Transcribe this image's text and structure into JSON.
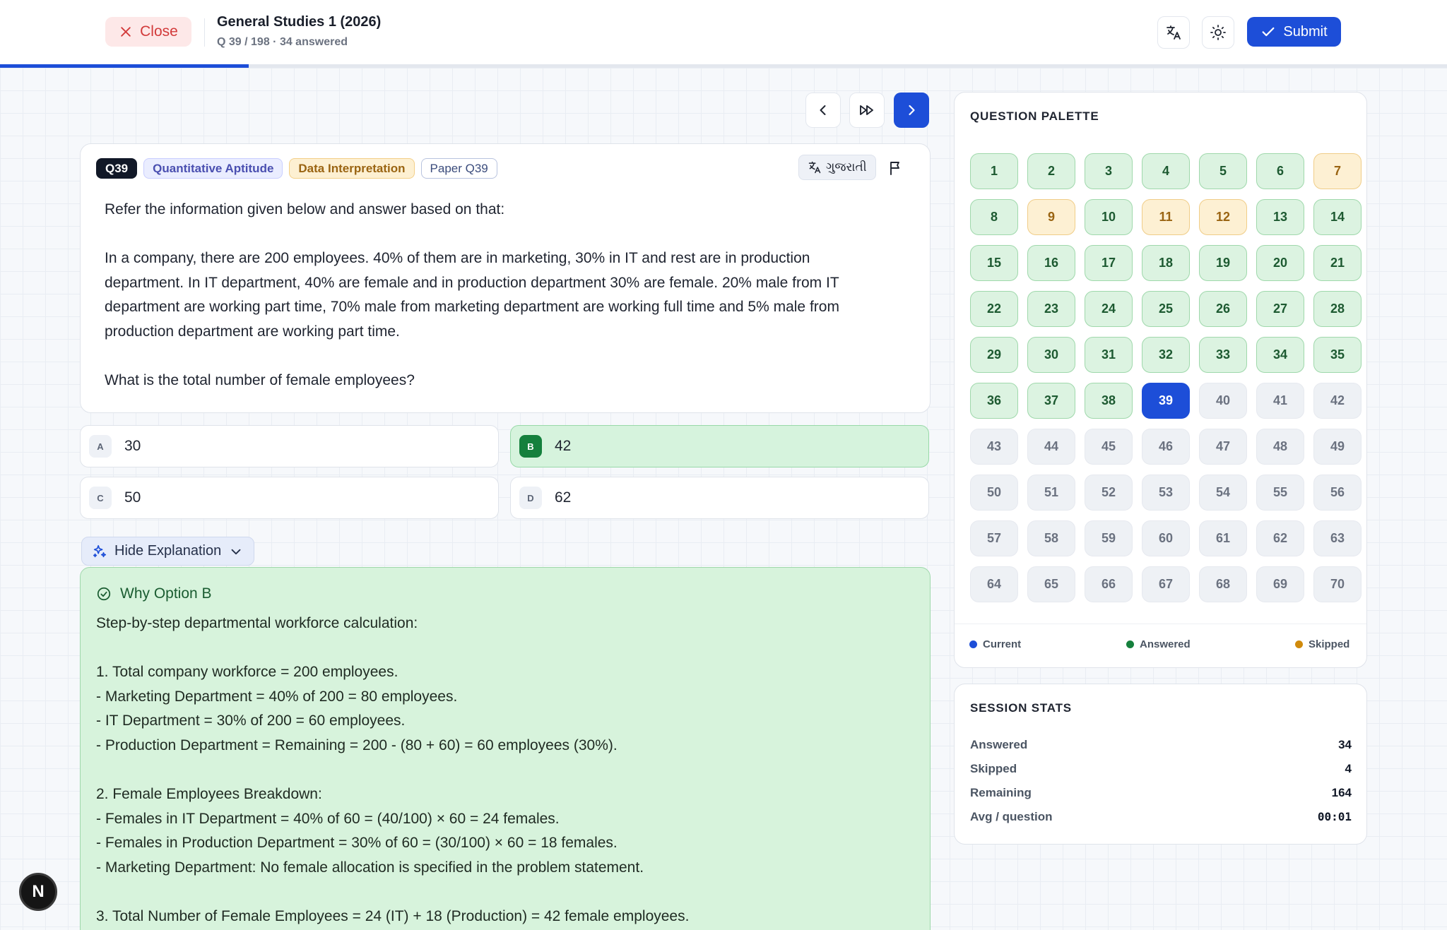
{
  "header": {
    "close_label": "Close",
    "title": "General Studies 1 (2026)",
    "subtitle": "Q 39 / 198 · 34 answered",
    "submit_label": "Submit",
    "progress_fraction": 0.172,
    "accent_color": "#1d4ed8"
  },
  "question": {
    "number_tag": "Q39",
    "subject_tag": "Quantitative Aptitude",
    "topic_tag": "Data Interpretation",
    "paper_tag": "Paper Q39",
    "language_label": "ગુજરાતી",
    "intro": "Refer the information given below and answer based on that:",
    "passage": [
      "In a company, there are 200 employees. 40% of them are in marketing, 30% in IT and rest are in production",
      "department. In IT department, 40% are female and in production department 30% are female. 20% male from IT",
      "department are working part time, 70% male from marketing department are working full time and 5% male from",
      "production department are working part time."
    ],
    "prompt": "What is the total number of female employees?"
  },
  "options": [
    {
      "letter": "A",
      "text": "30",
      "state": "default"
    },
    {
      "letter": "B",
      "text": "42",
      "state": "correct"
    },
    {
      "letter": "C",
      "text": "50",
      "state": "default"
    },
    {
      "letter": "D",
      "text": "62",
      "state": "default"
    }
  ],
  "explanation": {
    "toggle_label": "Hide Explanation",
    "heading": "Why Option B",
    "lines": [
      "Step-by-step departmental workforce calculation:",
      "",
      "1. Total company workforce = 200 employees.",
      "- Marketing Department = 40% of 200 = 80 employees.",
      "- IT Department = 30% of 200 = 60 employees.",
      "- Production Department = Remaining = 200 - (80 + 60) = 60 employees (30%).",
      "",
      "2. Female Employees Breakdown:",
      "- Females in IT Department = 40% of 60 = (40/100) × 60 = 24 females.",
      "- Females in Production Department = 30% of 60 = (30/100) × 60 = 18 females.",
      "- Marketing Department: No female allocation is specified in the problem statement.",
      "",
      "3. Total Number of Female Employees = 24 (IT) + 18 (Production) = 42 female employees."
    ]
  },
  "avatar_letter": "N",
  "palette": {
    "title": "QUESTION PALETTE",
    "total_visible": 70,
    "current": 39,
    "answered_through": 38,
    "skipped": [
      7,
      9,
      11,
      12
    ],
    "legend": [
      {
        "label": "Current",
        "color": "#1d4ed8"
      },
      {
        "label": "Answered",
        "color": "#15803d"
      },
      {
        "label": "Skipped",
        "color": "#d08a0c"
      }
    ]
  },
  "stats": {
    "title": "SESSION STATS",
    "rows": [
      {
        "label": "Answered",
        "value": "34"
      },
      {
        "label": "Skipped",
        "value": "4"
      },
      {
        "label": "Remaining",
        "value": "164"
      },
      {
        "label": "Avg / question",
        "value": "00:01"
      }
    ]
  }
}
